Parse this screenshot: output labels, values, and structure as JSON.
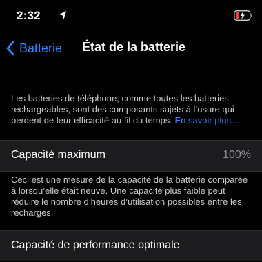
{
  "status_bar": {
    "time": "2:32"
  },
  "nav": {
    "back_label": "Batterie",
    "title": "État de la batterie"
  },
  "intro": {
    "text": "Les batteries de téléphone, comme toutes les batteries rechargeables, sont des composants sujets à l’usure qui perdent de leur efficacité au fil du temps. ",
    "link": "En savoir plus…"
  },
  "max_capacity": {
    "label": "Capacité maximum",
    "value": "100%",
    "description": "Ceci est une mesure de la capacité de la batterie comparée à lorsqu’elle était neuve. Une capacité plus faible peut réduire le nombre d’heures d’utilisation possibles entre les recharges."
  },
  "performance": {
    "label": "Capacité de performance optimale"
  },
  "colors": {
    "accent": "#2f87ff",
    "charging": "#ff3b30",
    "background": "#000000",
    "cell": "#1c1c1e"
  }
}
